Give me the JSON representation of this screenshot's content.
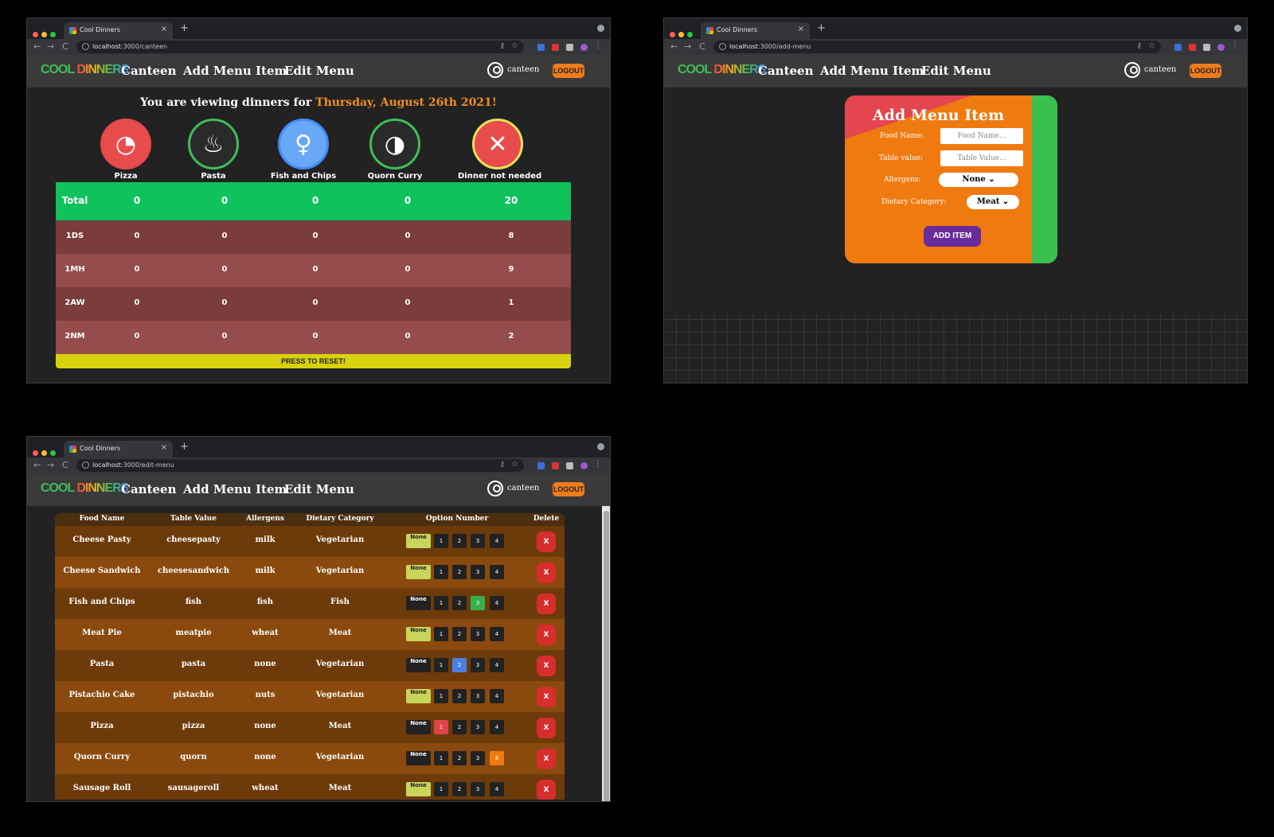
{
  "browser": {
    "tab_title": "Cool Dinners",
    "close": "×",
    "new_tab": "+",
    "back": "←",
    "forward": "→",
    "reload": "C",
    "key_icon": "⚷",
    "star_icon": "☆",
    "kebab": "⋮"
  },
  "windows": {
    "canteen": {
      "url_host": "localhost",
      "url_path": ":3000/canteen"
    },
    "add_menu": {
      "url_host": "localhost",
      "url_path": ":3000/add-menu"
    },
    "edit_menu": {
      "url_host": "localhost",
      "url_path": ":3000/edit-menu"
    }
  },
  "header": {
    "logo_a": "COOL ",
    "logo_b": "DINNERS",
    "nav": [
      "Canteen",
      "Add Menu Item",
      "Edit Menu"
    ],
    "user": "canteen",
    "logout": "LOGOUT"
  },
  "canteen": {
    "heading_prefix": "You are viewing dinners for",
    "date": "Thursday, August 26th 2021!",
    "options": [
      {
        "name": "Pizza",
        "icon": "pizza-icon",
        "ring": "#e34a4a",
        "bg": "#e84c4c"
      },
      {
        "name": "Pasta",
        "icon": "pasta-icon",
        "ring": "#3ebd5a",
        "bg": "#2a2a2a"
      },
      {
        "name": "Fish and Chips",
        "icon": "fish-and-chips-icon",
        "ring": "#3f8df2",
        "bg": "#6aa8f7"
      },
      {
        "name": "Quorn Curry",
        "icon": "curry-icon",
        "ring": "#3ebd5a",
        "bg": "#2a2a2a"
      },
      {
        "name": "Dinner not needed",
        "icon": "cross-icon",
        "ring": "#e5e35a",
        "bg": "#e84c4c"
      }
    ],
    "rows": [
      {
        "name": "Total",
        "values": [
          "0",
          "0",
          "0",
          "0",
          "20"
        ]
      },
      {
        "name": "1DS",
        "values": [
          "0",
          "0",
          "0",
          "0",
          "8"
        ]
      },
      {
        "name": "1MH",
        "values": [
          "0",
          "0",
          "0",
          "0",
          "9"
        ]
      },
      {
        "name": "2AW",
        "values": [
          "0",
          "0",
          "0",
          "0",
          "1"
        ]
      },
      {
        "name": "2NM",
        "values": [
          "0",
          "0",
          "0",
          "0",
          "2"
        ]
      }
    ],
    "reset": "PRESS TO RESET!"
  },
  "add_menu": {
    "title": "Add Menu Item",
    "food_label": "Food Name:",
    "food_placeholder": "Food Name...",
    "table_label": "Table value:",
    "table_placeholder": "Table Value...",
    "allergens_label": "Allergens:",
    "allergens_value": "None ⌄",
    "dietary_label": "Dietary Category:",
    "dietary_value": "Meat ⌄",
    "add_button": "ADD ITEM"
  },
  "edit_menu": {
    "headers": [
      "Food Name",
      "Table Value",
      "Allergens",
      "Dietary Category",
      "Option Number",
      "Delete"
    ],
    "option_labels": [
      "None",
      "1",
      "2",
      "3",
      "4"
    ],
    "delete_label": "X",
    "items": [
      {
        "food": "Cheese Pasty",
        "table": "cheesepasty",
        "allergen": "milk",
        "diet": "Vegetarian",
        "selected": "None"
      },
      {
        "food": "Cheese Sandwich",
        "table": "cheesesandwich",
        "allergen": "milk",
        "diet": "Vegetarian",
        "selected": "None"
      },
      {
        "food": "Fish and Chips",
        "table": "fish",
        "allergen": "fish",
        "diet": "Fish",
        "selected": "3"
      },
      {
        "food": "Meat Pie",
        "table": "meatpie",
        "allergen": "wheat",
        "diet": "Meat",
        "selected": "None"
      },
      {
        "food": "Pasta",
        "table": "pasta",
        "allergen": "none",
        "diet": "Vegetarian",
        "selected": "2"
      },
      {
        "food": "Pistachio Cake",
        "table": "pistachio",
        "allergen": "nuts",
        "diet": "Vegetarian",
        "selected": "None"
      },
      {
        "food": "Pizza",
        "table": "pizza",
        "allergen": "none",
        "diet": "Meat",
        "selected": "1"
      },
      {
        "food": "Quorn Curry",
        "table": "quorn",
        "allergen": "none",
        "diet": "Vegetarian",
        "selected": "4"
      },
      {
        "food": "Sausage Roll",
        "table": "sausageroll",
        "allergen": "wheat",
        "diet": "Meat",
        "selected": "None"
      }
    ]
  },
  "colors": {
    "accent_orange": "#ef7a10",
    "total_green": "#0fc25b",
    "reset_yellow": "#d7d10f",
    "delete_red": "#d62d2d"
  }
}
